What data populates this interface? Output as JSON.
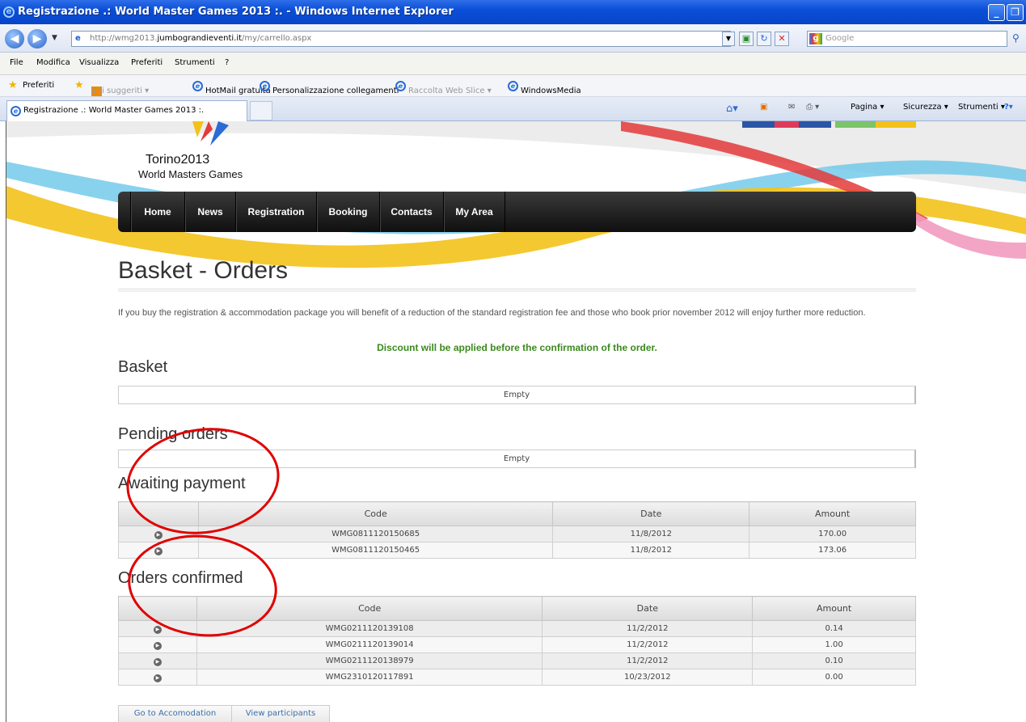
{
  "window": {
    "title": "Registrazione .: World Master Games 2013 :. - Windows Internet Explorer",
    "minimize": "_",
    "restore": "❐"
  },
  "address": {
    "url_prefix": "http://wmg2013.",
    "url_domain": "jumbograndieventi.it",
    "url_path": "/my/carrello.aspx",
    "search_placeholder": "Google"
  },
  "menu": [
    "File",
    "Modifica",
    "Visualizza",
    "Preferiti",
    "Strumenti",
    "?"
  ],
  "favorites": {
    "label": "Preferiti",
    "items": [
      "Siti suggeriti ▾",
      "HotMail gratuita",
      "Personalizzazione collegamenti",
      "Raccolta Web Slice ▾",
      "WindowsMedia"
    ]
  },
  "tab": {
    "title": "Registrazione .: World Master Games 2013 :."
  },
  "command_bar": [
    "Pagina ▾",
    "Sicurezza ▾",
    "Strumenti ▾"
  ],
  "site": {
    "logo_line1": "Torino2013",
    "logo_line2": "World Masters Games",
    "nav": [
      "Home",
      "News",
      "Registration",
      "Booking",
      "Contacts",
      "My Area"
    ]
  },
  "page": {
    "title": "Basket - Orders",
    "intro": "If you buy the registration & accommodation package you will benefit of a reduction of the standard registration fee and those who book prior november 2012 will enjoy further more reduction.",
    "discount_note": "Discount will be applied before the confirmation of the order.",
    "basket": {
      "heading": "Basket",
      "empty": "Empty"
    },
    "pending": {
      "heading": "Pending orders",
      "empty": "Empty"
    },
    "awaiting": {
      "heading": "Awaiting payment",
      "columns": [
        "",
        "Code",
        "Date",
        "Amount"
      ],
      "rows": [
        {
          "code": "WMG0811120150685",
          "date": "11/8/2012",
          "amount": "170.00"
        },
        {
          "code": "WMG0811120150465",
          "date": "11/8/2012",
          "amount": "173.06"
        }
      ]
    },
    "confirmed": {
      "heading": "Orders confirmed",
      "columns": [
        "",
        "Code",
        "Date",
        "Amount"
      ],
      "rows": [
        {
          "code": "WMG0211120139108",
          "date": "11/2/2012",
          "amount": "0.14"
        },
        {
          "code": "WMG0211120139014",
          "date": "11/2/2012",
          "amount": "1.00"
        },
        {
          "code": "WMG0211120138979",
          "date": "11/2/2012",
          "amount": "0.10"
        },
        {
          "code": "WMG2310120117891",
          "date": "10/23/2012",
          "amount": "0.00"
        }
      ]
    },
    "buttons": {
      "accommodation": "Go to Accomodation",
      "participants": "View participants"
    }
  },
  "colors": {
    "annotation": "#e00000",
    "discount": "#3b8a1e",
    "nav_bg": "#111111"
  }
}
